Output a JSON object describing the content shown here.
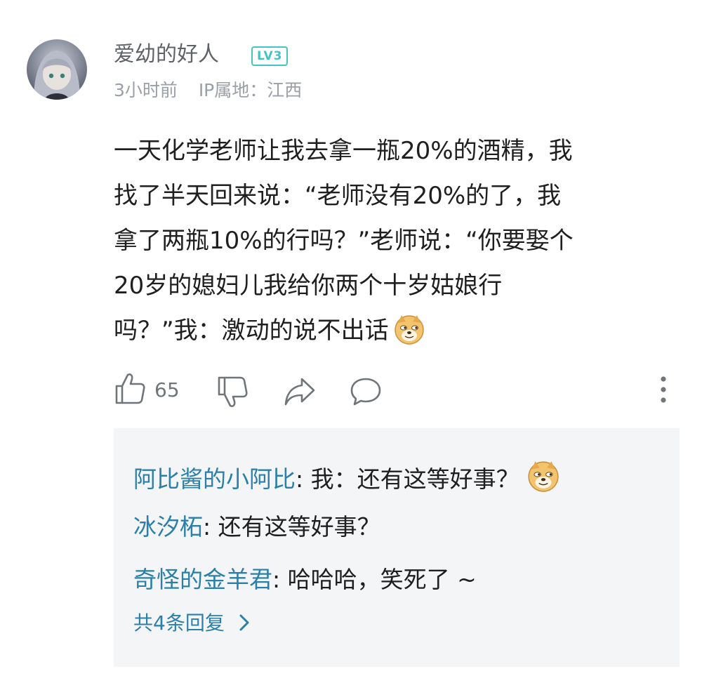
{
  "comment": {
    "username": "爱幼的好人",
    "level_badge": "LV3",
    "time": "3小时前",
    "ip_location": "IP属地：江西",
    "content_lines": [
      "一天化学老师让我去拿一瓶20%的酒精，我",
      "找了半天回来说：“老师没有20%的了，我",
      "拿了两瓶10%的行吗？”老师说：“你要娶个",
      "20岁的媳妇儿我给你两个十岁姑娘行",
      "吗？”我：激动的说不出话"
    ],
    "emoji_name": "doge-emoji"
  },
  "actions": {
    "like_count": "65",
    "like_icon": "thumb-up-icon",
    "dislike_icon": "thumb-down-icon",
    "share_icon": "share-icon",
    "reply_icon": "comment-icon",
    "more_icon": "more-vertical-icon"
  },
  "replies": {
    "items": [
      {
        "author": "阿比酱的小阿比",
        "text": ": 我：还有这等好事？",
        "emoji": true
      },
      {
        "author": "冰汐柘",
        "text": ": 还有这等好事？",
        "emoji": false
      },
      {
        "author": "奇怪的金羊君",
        "text": ": 哈哈哈，笑死了 ~",
        "emoji": false
      }
    ],
    "more_label": "共4条回复"
  },
  "colors": {
    "accent_link": "#2b7fa8",
    "badge": "#43c3c4",
    "reply_bg": "#f4f5f7"
  }
}
